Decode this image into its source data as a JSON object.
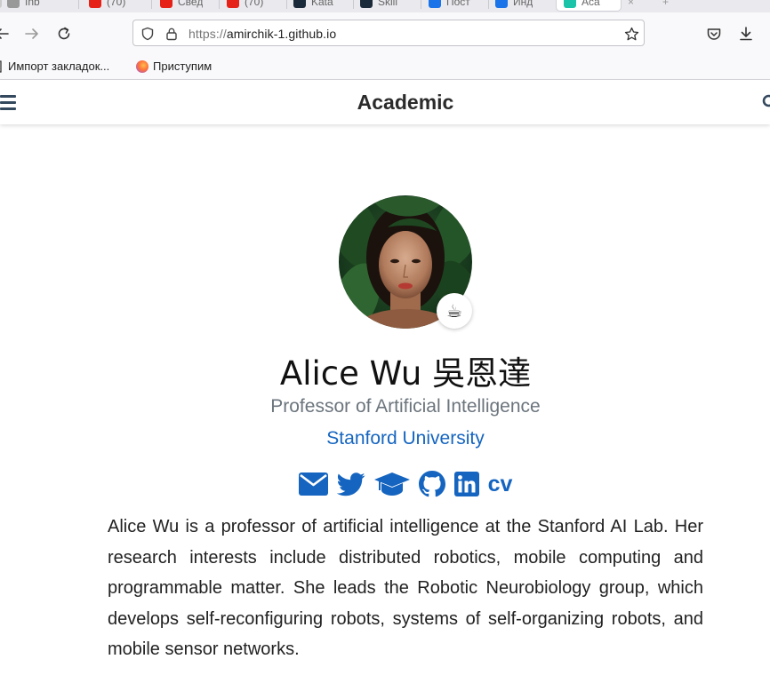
{
  "browser": {
    "tabs": [
      {
        "label": "Inb",
        "favicon_color": "#888888"
      },
      {
        "label": "(70)",
        "favicon_color": "#e62117"
      },
      {
        "label": "Свед",
        "favicon_color": "#e62117"
      },
      {
        "label": "(70)",
        "favicon_color": "#e62117"
      },
      {
        "label": "Kata",
        "favicon_color": "#1b2a3a"
      },
      {
        "label": "Skill",
        "favicon_color": "#1b2a3a"
      },
      {
        "label": "Пост",
        "favicon_color": "#1a73e8"
      },
      {
        "label": "Инд",
        "favicon_color": "#1a73e8"
      },
      {
        "label": "Aca",
        "favicon_color": "#1bc4a9",
        "active": true
      }
    ],
    "url": {
      "scheme": "https://",
      "host": "amirchik-1.github.io"
    },
    "bookmarks": [
      {
        "label": "Импорт закладок..."
      },
      {
        "label": "Приступим"
      }
    ]
  },
  "site": {
    "title": "Academic"
  },
  "profile": {
    "name": "Alice Wu 吳恩達",
    "role": "Professor of Artificial Intelligence",
    "organization": "Stanford University",
    "status_emoji": "☕",
    "social": [
      {
        "icon": "envelope-icon"
      },
      {
        "icon": "twitter-icon"
      },
      {
        "icon": "graduation-cap-icon"
      },
      {
        "icon": "github-icon"
      },
      {
        "icon": "linkedin-icon"
      },
      {
        "icon": "cv-icon",
        "label": "cv"
      }
    ],
    "bio": "Alice Wu is a professor of artificial intelligence at the Stanford AI Lab. Her research interests include distributed robotics, mobile computing and programmable matter. She leads the Robotic Neurobiology group, which develops self-reconfiguring robots, systems of self-organizing robots, and mobile sensor networks."
  },
  "colors": {
    "link": "#1565c0",
    "muted": "#6c757d",
    "header_icon": "#34495e"
  }
}
